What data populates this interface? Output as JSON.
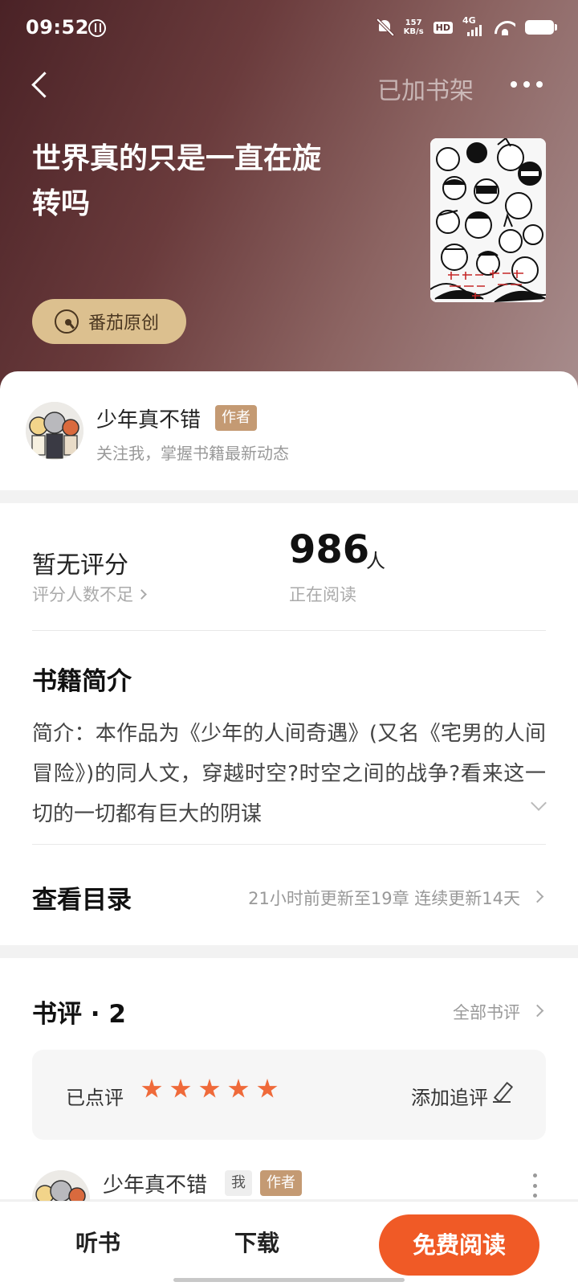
{
  "status_bar": {
    "time": "09:52",
    "net_speed_value": "157",
    "net_speed_unit": "KB/s",
    "hd": "HD",
    "network": "4G"
  },
  "header": {
    "shelf_label": "已加书架"
  },
  "book": {
    "title": "世界真的只是一直在旋转吗",
    "badge": "番茄原创"
  },
  "author": {
    "name": "少年真不错",
    "role_tag": "作者",
    "subtitle": "关注我，掌握书籍最新动态"
  },
  "stats": {
    "rating_title": "暂无评分",
    "rating_sub": "评分人数不足",
    "readers": "986",
    "readers_unit": "人",
    "readers_label": "正在阅读"
  },
  "intro": {
    "title": "书籍简介",
    "text": "简介：本作品为《少年的人间奇遇》(又名《宅男的人间冒险》)的同人文，穿越时空?时空之间的战争?看来这一切的一切都有巨大的阴谋"
  },
  "toc": {
    "title": "查看目录",
    "info": "21小时前更新至19章 连续更新14天"
  },
  "reviews": {
    "title": "书评 · 2",
    "all_label": "全部书评",
    "my_review_label": "已点评",
    "stars": 5,
    "add_followup": "添加追评",
    "first_review": {
      "name": "少年真不错",
      "tag_me": "我",
      "tag_author": "作者"
    }
  },
  "bottom_bar": {
    "listen": "听书",
    "download": "下载",
    "read": "免费阅读"
  },
  "colors": {
    "accent": "#f05a26",
    "star": "#ef6a3a",
    "author_tag": "#c49a73",
    "badge": "#dcc08f"
  }
}
